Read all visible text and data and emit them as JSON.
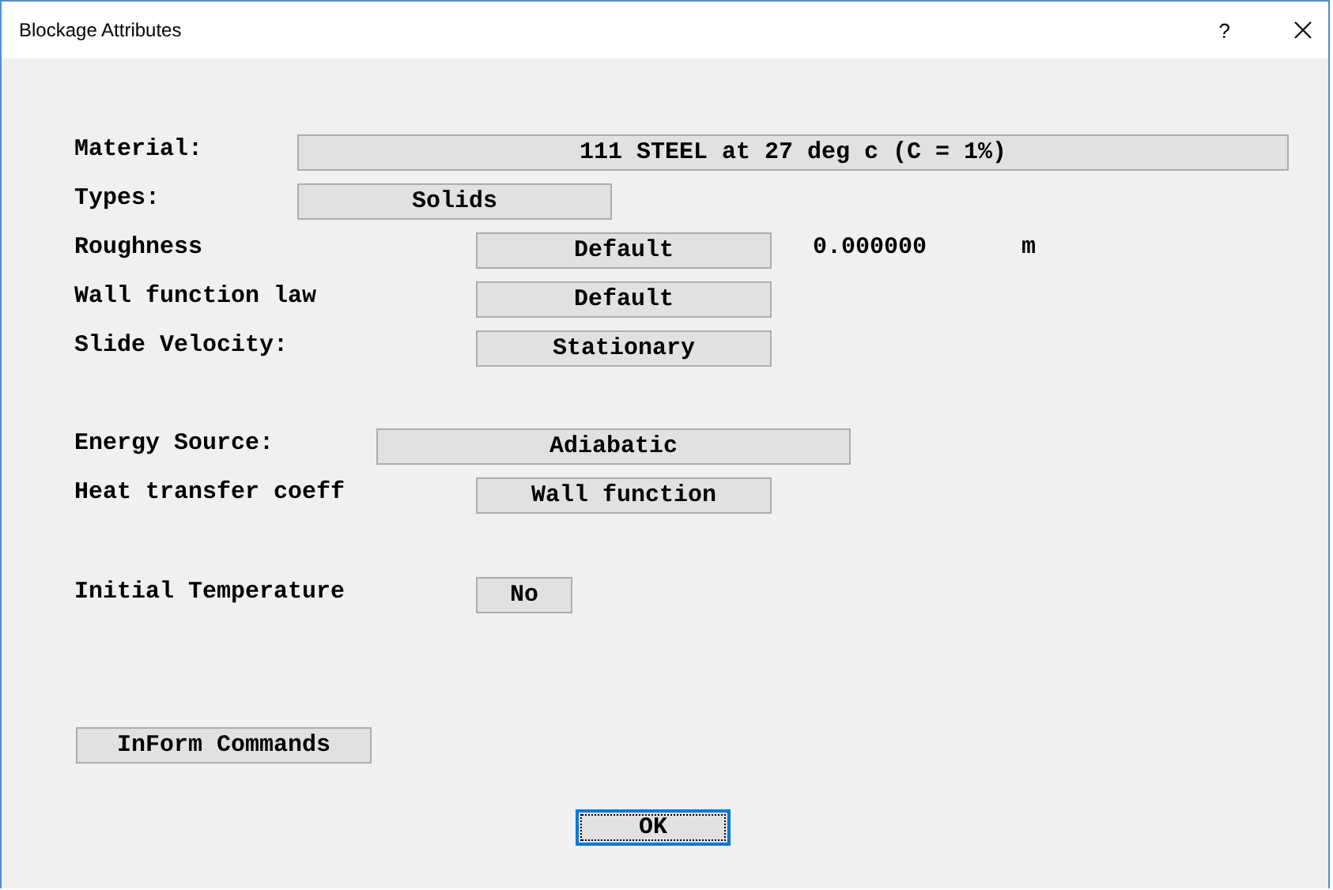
{
  "window": {
    "title": "Blockage Attributes",
    "help": "?"
  },
  "fields": [
    {
      "label": "Material:",
      "value": "111 STEEL at 27 deg c (C = 1%)"
    },
    {
      "label": "Types:",
      "value": "Solids"
    },
    {
      "label": "Roughness",
      "value": "Default",
      "reading": "0.000000",
      "unit": "m"
    },
    {
      "label": "Wall function law",
      "value": "Default"
    },
    {
      "label": "Slide Velocity:",
      "value": "Stationary"
    },
    {
      "label": "Energy Source:",
      "value": "Adiabatic"
    },
    {
      "label": "Heat transfer coeff",
      "value": "Wall function"
    },
    {
      "label": "Initial Temperature",
      "value": "No"
    }
  ],
  "inform_button": "InForm Commands",
  "ok_button": {
    "label": "OK",
    "focused": true
  }
}
